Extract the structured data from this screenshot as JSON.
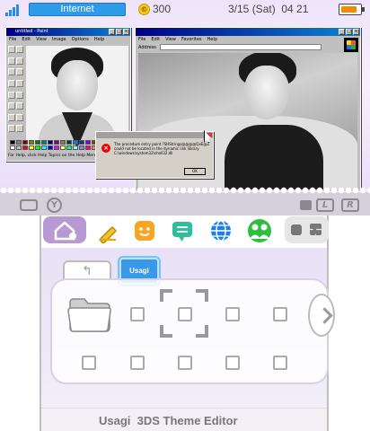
{
  "status": {
    "network_label": "Internet",
    "coin_count": "300",
    "date_time": "3/15 (Sat)  04 21",
    "battery_level": 0.85
  },
  "paint": {
    "title": "untitled - Paint",
    "menu": [
      "File",
      "Edit",
      "View",
      "Image",
      "Options",
      "Help"
    ],
    "status_text": "For Help, click Help Topics on the Help Menu.",
    "palette": [
      "#000000",
      "#808080",
      "#800000",
      "#808000",
      "#008000",
      "#008080",
      "#000080",
      "#800080",
      "#808040",
      "#004040",
      "#0080ff",
      "#004080",
      "#8000ff",
      "#804000",
      "#ffffff",
      "#c0c0c0",
      "#ff0000",
      "#ffff00",
      "#00ff00",
      "#00ffff",
      "#0000ff",
      "#ff00ff",
      "#ffff80",
      "#00ff80",
      "#80ffff",
      "#8080ff",
      "#ff0080",
      "#ff8040"
    ]
  },
  "browser": {
    "menu": [
      "File",
      "Edit",
      "View",
      "Favorites",
      "Help"
    ],
    "address_label": "Address"
  },
  "error_dialog": {
    "message": "The procedure entry point ?SHStrings@@@@QxE@Z could not be located in the dynamic link library C:\\windows\\system32\\shell32.dll",
    "ok_label": "OK"
  },
  "shoulder": {
    "y_label": "Y",
    "l_label": "L",
    "r_label": "R"
  },
  "bottom": {
    "back_label": "↰",
    "folder_tab_label": "Usagi",
    "footer_text": "Usagi  3DS Theme Editor"
  }
}
